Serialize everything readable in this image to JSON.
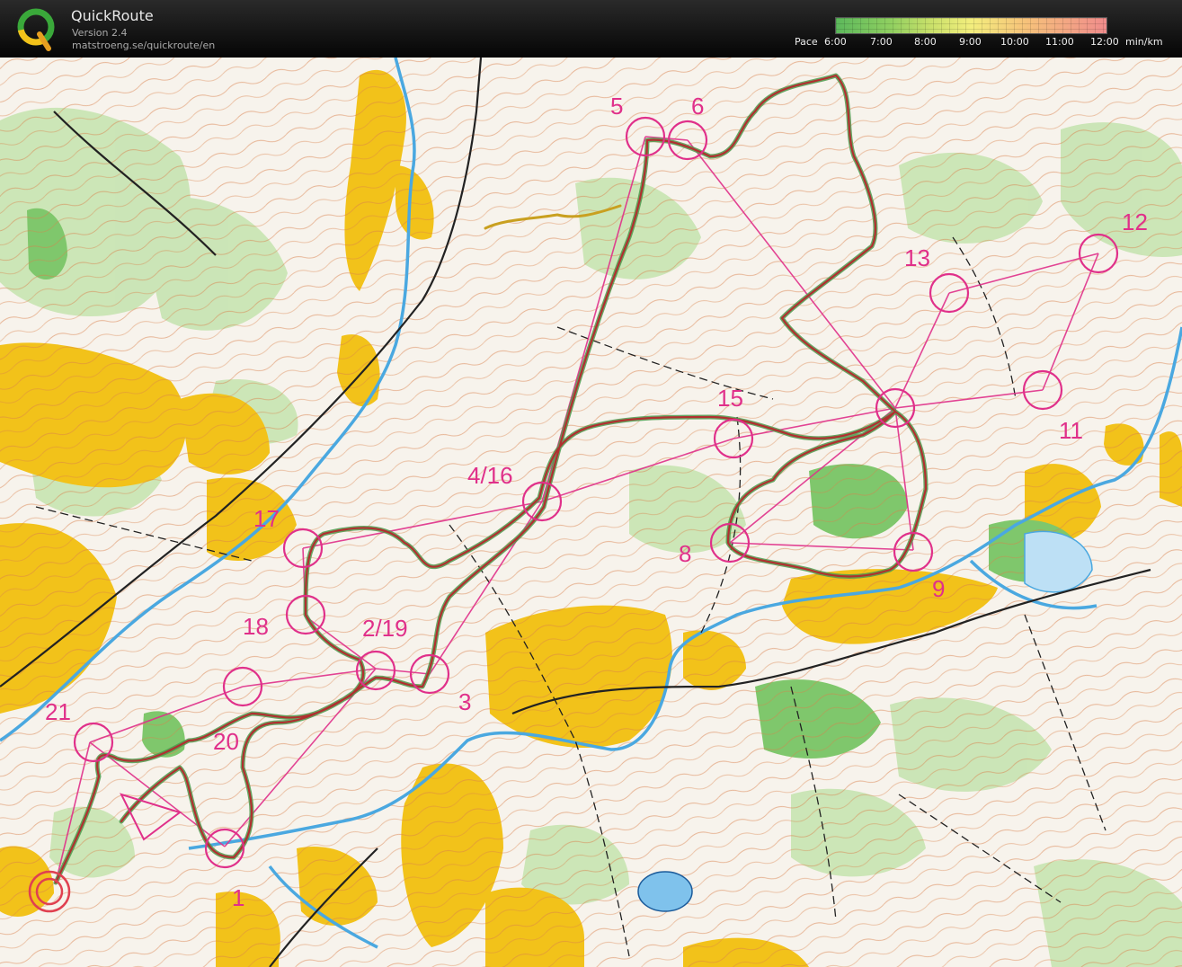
{
  "header": {
    "title": "QuickRoute",
    "version": "Version 2.4",
    "url": "matstroeng.se/quickroute/en",
    "logo_letter": "Q"
  },
  "pace_scale": {
    "label": "Pace",
    "ticks": [
      "6:00",
      "7:00",
      "8:00",
      "9:00",
      "10:00",
      "11:00",
      "12:00"
    ],
    "unit": "min/km",
    "colors": [
      "#5cb85c",
      "#c9e06a",
      "#f3ee7d",
      "#f08c8c"
    ]
  },
  "map": {
    "colors": {
      "paper": "#f7f3ec",
      "open_land": "#f2c21a",
      "forest_green": "#7fc76c",
      "light_green": "#c4e3ae",
      "water": "#4aa8e0",
      "contours": "#d9804a",
      "course": "#e0308a",
      "route": "#b03030"
    },
    "controls": [
      {
        "label": "1"
      },
      {
        "label": "2/19"
      },
      {
        "label": "3"
      },
      {
        "label": "4/16"
      },
      {
        "label": "5"
      },
      {
        "label": "6"
      },
      {
        "label": "8"
      },
      {
        "label": "9"
      },
      {
        "label": "11"
      },
      {
        "label": "12"
      },
      {
        "label": "13"
      },
      {
        "label": "15"
      },
      {
        "label": "17"
      },
      {
        "label": "18"
      },
      {
        "label": "20"
      },
      {
        "label": "21"
      }
    ]
  }
}
